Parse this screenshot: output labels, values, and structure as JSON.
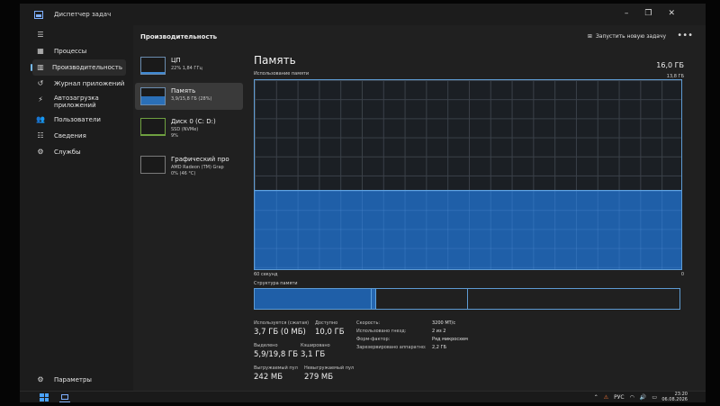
{
  "window": {
    "title": "Диспетчер задач",
    "controls": [
      "–",
      "❐",
      "✕"
    ]
  },
  "nav": {
    "items": [
      {
        "label": "Процессы",
        "icon": "grid-icon"
      },
      {
        "label": "Производительность",
        "icon": "performance-icon"
      },
      {
        "label": "Журнал приложений",
        "icon": "history-icon"
      },
      {
        "label": "Автозагрузка приложений",
        "icon": "startup-icon"
      },
      {
        "label": "Пользователи",
        "icon": "users-icon"
      },
      {
        "label": "Сведения",
        "icon": "details-icon"
      },
      {
        "label": "Службы",
        "icon": "services-icon"
      }
    ],
    "settings_label": "Параметры"
  },
  "header": {
    "title": "Производительность",
    "run_task": "Запустить новую задачу",
    "more": "•••"
  },
  "devices": [
    {
      "name": "ЦП",
      "sub": "22% 1,84 ГГц"
    },
    {
      "name": "Память",
      "sub": "3,9/15,8 ГБ (28%)"
    },
    {
      "name": "Диск 0 (C: D:)",
      "sub": "SSD (NVMe)",
      "sub2": "9%"
    },
    {
      "name": "Графический про",
      "sub": "AMD Radeon (TM) Grap",
      "sub2": "0% (46 °C)"
    }
  ],
  "memory": {
    "title": "Память",
    "total": "16,0 ГБ",
    "usage_label": "Использование памяти",
    "usage_max": "13,8 ГБ",
    "graph_left": "60 секунд",
    "graph_right": "0",
    "usage_fraction": 0.28,
    "structure_label": "Структура памяти",
    "stats": {
      "in_use_label": "Используется (сжатая)",
      "in_use": "3,7 ГБ (0 МБ)",
      "available_label": "Доступно",
      "available": "10,0 ГБ",
      "committed_label": "Выделено",
      "committed": "5,9/19,8 ГБ",
      "cached_label": "Кэшировано",
      "cached": "3,1 ГБ",
      "paged_label": "Выгружаемый пул",
      "paged": "242 МБ",
      "nonpaged_label": "Невыгружаемый пул",
      "nonpaged": "279 МБ"
    },
    "details": [
      {
        "k": "Скорость:",
        "v": "3200 МТ/с"
      },
      {
        "k": "Использовано гнезд:",
        "v": "2 из 2"
      },
      {
        "k": "Форм-фактор:",
        "v": "Ряд микросхем"
      },
      {
        "k": "Зарезервировано аппаратно:",
        "v": "2,2 ГБ"
      }
    ]
  },
  "taskbar": {
    "lang": "РУС",
    "time": "23:20",
    "date": "06.08.2026"
  },
  "colors": {
    "accent": "#76b9ed",
    "memory_fill": "#1f5fa8",
    "warning": "#ff7a3c"
  }
}
